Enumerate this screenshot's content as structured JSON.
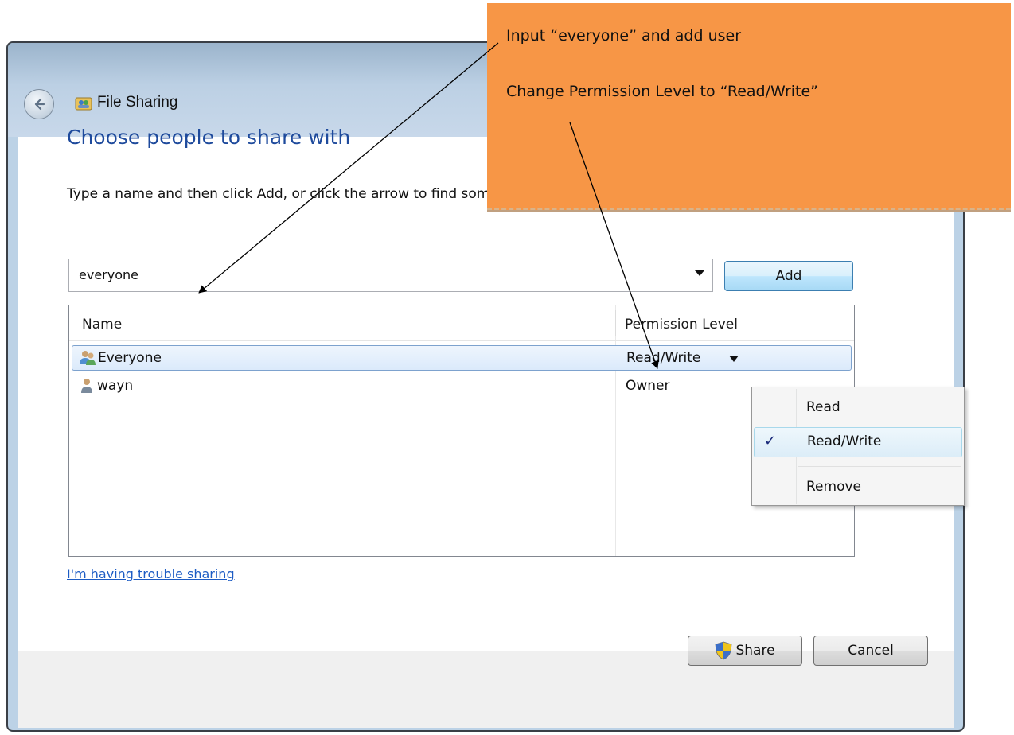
{
  "window": {
    "title": "File Sharing"
  },
  "content": {
    "heading": "Choose people to share with",
    "instruction": "Type a name and then click Add, or click the arrow to find someone."
  },
  "name_input": {
    "value": "everyone"
  },
  "add_button": {
    "label": "Add"
  },
  "user_list": {
    "columns": [
      "Name",
      "Permission Level"
    ],
    "rows": [
      {
        "name": "Everyone",
        "permission": "Read/Write",
        "icon": "group-icon",
        "selected": true
      },
      {
        "name": "wayn",
        "permission": "Owner",
        "icon": "user-icon",
        "selected": false
      }
    ]
  },
  "permission_menu": {
    "items": [
      {
        "label": "Read",
        "checked": false
      },
      {
        "label": "Read/Write",
        "checked": true
      },
      {
        "label": "Remove",
        "checked": false
      }
    ],
    "check_glyph": "✓"
  },
  "trouble_link": "I'm having trouble sharing",
  "footer": {
    "share_label": "Share",
    "cancel_label": "Cancel"
  },
  "callout": {
    "line1": "Input “everyone” and add user",
    "line2": "Change Permission Level to “Read/Write”"
  },
  "colors": {
    "heading": "#1e4a9c",
    "link": "#1d5cc4",
    "callout": "#f79646",
    "selection": "#dbeafb"
  }
}
